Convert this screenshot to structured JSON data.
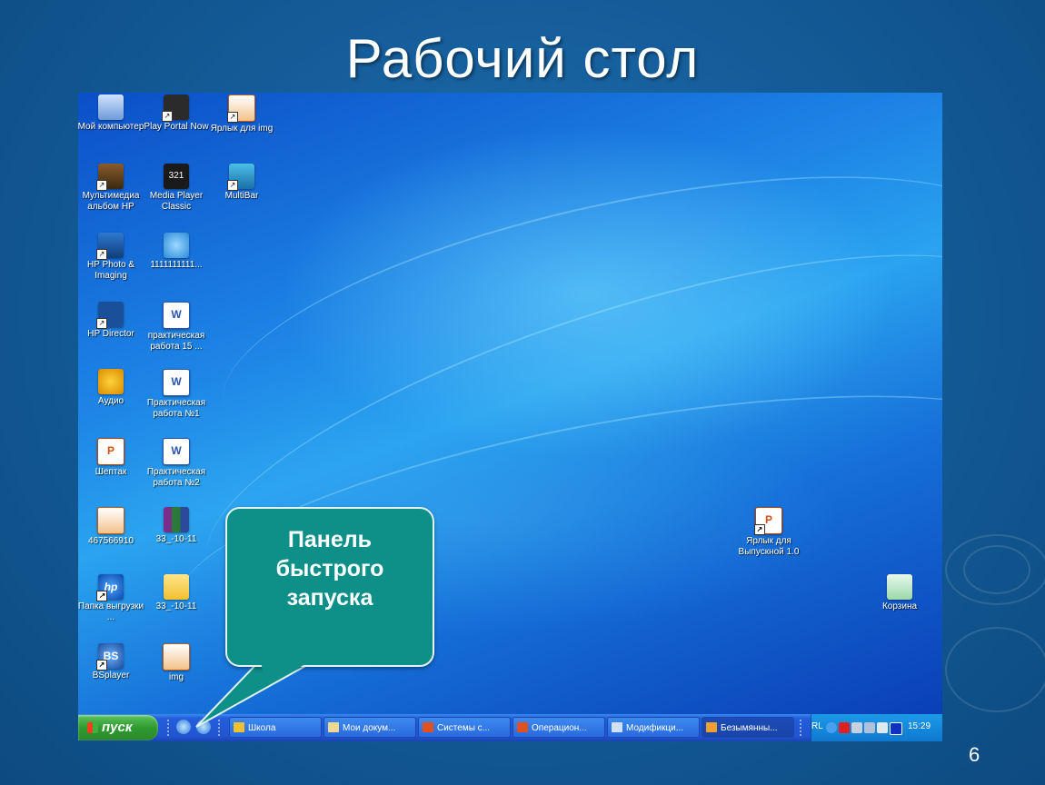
{
  "slide": {
    "title": "Рабочий стол",
    "number": "6"
  },
  "desktop_icons": [
    {
      "label": "Мой компьютер",
      "icon": "my-computer-icon"
    },
    {
      "label": "Play Portal Now",
      "icon": "play-portal-icon"
    },
    {
      "label": "Ярлык для img",
      "icon": "image-shortcut-icon"
    },
    {
      "label": "Мультимедиа альбом HP",
      "icon": "multimedia-album-icon"
    },
    {
      "label": "Media Player Classic",
      "icon": "media-player-icon"
    },
    {
      "label": "MultiBar",
      "icon": "multibar-icon"
    },
    {
      "label": "HP Photo & Imaging",
      "icon": "hp-photo-icon"
    },
    {
      "label": "1111111111...",
      "icon": "cloud-download-icon"
    },
    {
      "label": "HP Director",
      "icon": "hp-director-icon"
    },
    {
      "label": "практическая работа 15 ...",
      "icon": "word-document-icon"
    },
    {
      "label": "Аудио",
      "icon": "audio-icon"
    },
    {
      "label": "Практическая работа №1",
      "icon": "word-document-icon"
    },
    {
      "label": "Шептак",
      "icon": "powerpoint-icon"
    },
    {
      "label": "Практическая работа №2",
      "icon": "word-document-icon"
    },
    {
      "label": "467566910",
      "icon": "image-file-icon"
    },
    {
      "label": "33_-10-11",
      "icon": "winrar-archive-icon"
    },
    {
      "label": "Папка выгрузки ...",
      "icon": "hp-folder-icon"
    },
    {
      "label": "33_-10-11",
      "icon": "folder-icon"
    },
    {
      "label": "BSplayer",
      "icon": "bsplayer-icon"
    },
    {
      "label": "img",
      "icon": "image-file-icon"
    },
    {
      "label": "Ярлык для Выпускной 1.0",
      "icon": "powerpoint-shortcut-icon"
    },
    {
      "label": "Корзина",
      "icon": "recycle-bin-icon"
    }
  ],
  "callout": {
    "text_line1": "Панель",
    "text_line2": "быстрого",
    "text_line3": "запуска"
  },
  "taskbar": {
    "start_label": "пуск",
    "buttons": [
      {
        "label": "Школа",
        "icon": "folder-icon"
      },
      {
        "label": "Мои докум...",
        "icon": "my-documents-icon"
      },
      {
        "label": "Системы с...",
        "icon": "powerpoint-icon"
      },
      {
        "label": "Операцион...",
        "icon": "powerpoint-icon"
      },
      {
        "label": "Модификци...",
        "icon": "window-icon"
      },
      {
        "label": "Безымянны...",
        "icon": "paint-icon"
      }
    ],
    "language": "RL",
    "clock": "15:29"
  },
  "colors": {
    "start_green": "#2f9a2f",
    "taskbar_blue": "#245edb",
    "callout_teal": "#0e8f88"
  }
}
